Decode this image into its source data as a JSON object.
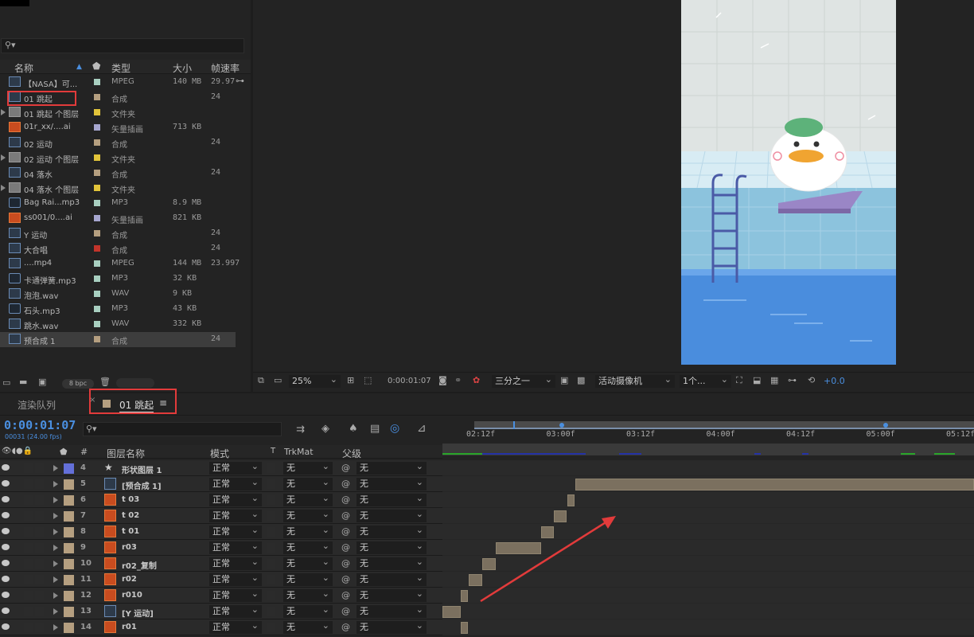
{
  "project": {
    "search_placeholder": "",
    "columns": {
      "name": "名称",
      "type": "类型",
      "size": "大小",
      "fps": "帧速率"
    },
    "items": [
      {
        "name": "【NASA】可...",
        "type": "MPEG",
        "size": "140 MB",
        "fps": "29.97",
        "color": "#a8cfc0",
        "icon": "video-file-icon",
        "folder": false
      },
      {
        "name": "01 跳起",
        "type": "合成",
        "size": "",
        "fps": "24",
        "color": "#b59f80",
        "icon": "composition-icon",
        "folder": false,
        "highlighted": true
      },
      {
        "name": "01 跳起 个图层",
        "type": "文件夹",
        "size": "",
        "fps": "",
        "color": "#e2c43a",
        "icon": "folder-icon",
        "folder": true
      },
      {
        "name": "01r_xx/....ai",
        "type": "矢量插画",
        "size": "713 KB",
        "fps": "",
        "color": "#a6a6cf",
        "icon": "illustrator-file-icon",
        "folder": false
      },
      {
        "name": "02 运动",
        "type": "合成",
        "size": "",
        "fps": "24",
        "color": "#b59f80",
        "icon": "composition-icon",
        "folder": false
      },
      {
        "name": "02 运动 个图层",
        "type": "文件夹",
        "size": "",
        "fps": "",
        "color": "#e2c43a",
        "icon": "folder-icon",
        "folder": true
      },
      {
        "name": "04 落水",
        "type": "合成",
        "size": "",
        "fps": "24",
        "color": "#b59f80",
        "icon": "composition-icon",
        "folder": false
      },
      {
        "name": "04 落水 个图层",
        "type": "文件夹",
        "size": "",
        "fps": "",
        "color": "#e2c43a",
        "icon": "folder-icon",
        "folder": true
      },
      {
        "name": "Bag Rai...mp3",
        "type": "MP3",
        "size": "8.9 MB",
        "fps": "",
        "color": "#a8cfc0",
        "icon": "audio-file-icon",
        "folder": false
      },
      {
        "name": "ss001/0....ai",
        "type": "矢量插画",
        "size": "821 KB",
        "fps": "",
        "color": "#a6a6cf",
        "icon": "illustrator-file-icon",
        "folder": false
      },
      {
        "name": "Y 运动",
        "type": "合成",
        "size": "",
        "fps": "24",
        "color": "#b59f80",
        "icon": "composition-icon",
        "folder": false
      },
      {
        "name": "大合唱",
        "type": "合成",
        "size": "",
        "fps": "24",
        "color": "#c2342b",
        "icon": "composition-icon",
        "folder": false
      },
      {
        "name": "....mp4",
        "type": "MPEG",
        "size": "144 MB",
        "fps": "23.997",
        "color": "#a8cfc0",
        "icon": "video-file-icon",
        "folder": false
      },
      {
        "name": "卡通弹簧.mp3",
        "type": "MP3",
        "size": "32 KB",
        "fps": "",
        "color": "#a8cfc0",
        "icon": "audio-file-icon",
        "folder": false
      },
      {
        "name": "泡泡.wav",
        "type": "WAV",
        "size": "9 KB",
        "fps": "",
        "color": "#a8cfc0",
        "icon": "wav-file-icon",
        "folder": false
      },
      {
        "name": "石头.mp3",
        "type": "MP3",
        "size": "43 KB",
        "fps": "",
        "color": "#a8cfc0",
        "icon": "audio-file-icon",
        "folder": false
      },
      {
        "name": "跳水.wav",
        "type": "WAV",
        "size": "332 KB",
        "fps": "",
        "color": "#a8cfc0",
        "icon": "wav-file-icon",
        "folder": false
      },
      {
        "name": "预合成 1",
        "type": "合成",
        "size": "",
        "fps": "24",
        "color": "#b59f80",
        "icon": "composition-icon",
        "folder": false,
        "selected": true
      }
    ],
    "bpc": "8 bpc"
  },
  "viewer": {
    "zoom": "25%",
    "timecode": "0:00:01:07",
    "resolution": "三分之一",
    "camera": "活动摄像机",
    "views": "1个...",
    "exposure": "+0.0"
  },
  "timeline": {
    "render_queue_tab": "渲染队列",
    "comp_tab": "01 跳起",
    "current_time": "0:00:01:07",
    "frame_info": "00031 (24.00 fps)",
    "columns": {
      "num": "#",
      "layer_name": "图层名称",
      "mode": "模式",
      "t": "T",
      "trkmat": "TrkMat",
      "parent": "父级"
    },
    "ruler": [
      "02:12f",
      "03:00f",
      "03:12f",
      "04:00f",
      "04:12f",
      "05:00f",
      "05:12f"
    ],
    "layers": [
      {
        "num": "4",
        "name": "形状图层 1",
        "mode": "正常",
        "trkmat": "无",
        "parent": "无",
        "color": "#6470d9",
        "icon": "star-shape-icon",
        "bar_start": 0.0,
        "bar_end": 0.0
      },
      {
        "num": "5",
        "name": "[预合成 1]",
        "mode": "正常",
        "trkmat": "无",
        "parent": "无",
        "color": "#b59f80",
        "icon": "composition-icon",
        "bar_start": 0.25,
        "bar_end": 1.0
      },
      {
        "num": "6",
        "name": "t 03",
        "mode": "正常",
        "trkmat": "无",
        "parent": "无",
        "color": "#b59f80",
        "icon": "ai-layer-icon",
        "bar_start": 0.235,
        "bar_end": 0.248
      },
      {
        "num": "7",
        "name": "t 02",
        "mode": "正常",
        "trkmat": "无",
        "parent": "无",
        "color": "#b59f80",
        "icon": "ai-layer-icon",
        "bar_start": 0.21,
        "bar_end": 0.233
      },
      {
        "num": "8",
        "name": "t 01",
        "mode": "正常",
        "trkmat": "无",
        "parent": "无",
        "color": "#b59f80",
        "icon": "ai-layer-icon",
        "bar_start": 0.185,
        "bar_end": 0.21
      },
      {
        "num": "9",
        "name": "r03",
        "mode": "正常",
        "trkmat": "无",
        "parent": "无",
        "color": "#b59f80",
        "icon": "ai-layer-icon",
        "bar_start": 0.1,
        "bar_end": 0.185
      },
      {
        "num": "10",
        "name": "r02_复制",
        "mode": "正常",
        "trkmat": "无",
        "parent": "无",
        "color": "#b59f80",
        "icon": "ai-layer-icon",
        "bar_start": 0.075,
        "bar_end": 0.1
      },
      {
        "num": "11",
        "name": "r02",
        "mode": "正常",
        "trkmat": "无",
        "parent": "无",
        "color": "#b59f80",
        "icon": "ai-layer-icon",
        "bar_start": 0.05,
        "bar_end": 0.075
      },
      {
        "num": "12",
        "name": "r010",
        "mode": "正常",
        "trkmat": "无",
        "parent": "无",
        "color": "#b59f80",
        "icon": "ai-layer-icon",
        "bar_start": 0.035,
        "bar_end": 0.048
      },
      {
        "num": "13",
        "name": "[Y 运动]",
        "mode": "正常",
        "trkmat": "无",
        "parent": "无",
        "color": "#b59f80",
        "icon": "composition-icon",
        "bar_start": 0.0,
        "bar_end": 0.035
      },
      {
        "num": "14",
        "name": "r01",
        "mode": "正常",
        "trkmat": "无",
        "parent": "无",
        "color": "#b59f80",
        "icon": "ai-layer-icon",
        "bar_start": 0.035,
        "bar_end": 0.048
      }
    ]
  }
}
